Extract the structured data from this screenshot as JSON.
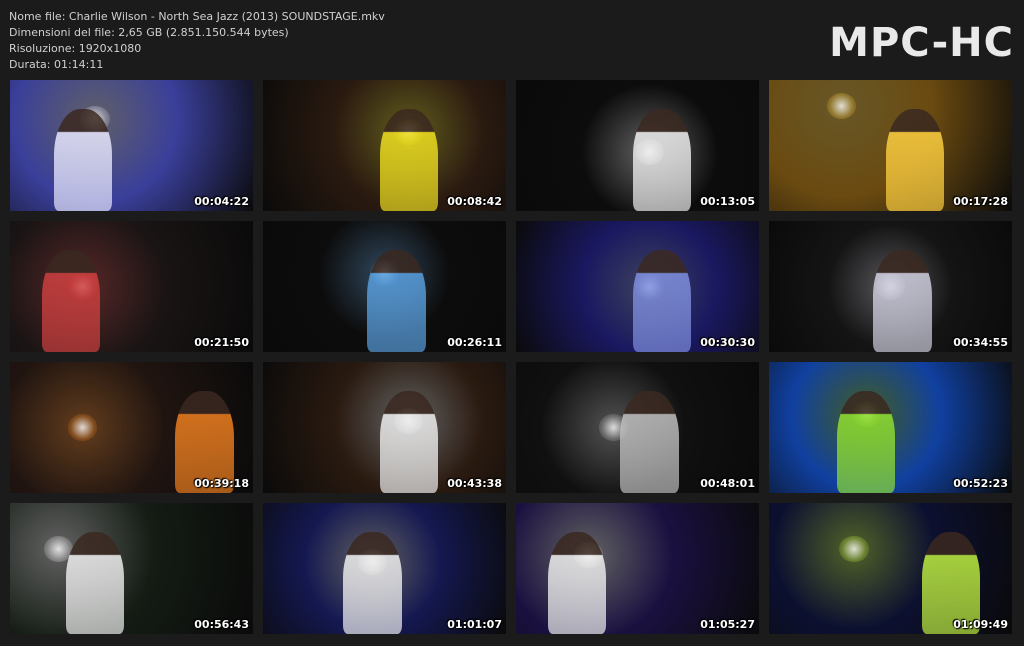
{
  "file_info": {
    "name_line": "Nome file: Charlie Wilson - North Sea Jazz (2013) SOUNDSTAGE.mkv",
    "size_line": "Dimensioni del file: 2,65 GB (2.851.150.544 bytes)",
    "resolution_line": "Risoluzione: 1920x1080",
    "duration_line": "Durata: 01:14:11"
  },
  "logo": "MPC-HC",
  "thumbnails": [
    {
      "timestamp": "00:04:22",
      "bg": "#3a3f9a",
      "accent": "#e8e8ff"
    },
    {
      "timestamp": "00:08:42",
      "bg": "#2a1a10",
      "accent": "#f0e020"
    },
    {
      "timestamp": "00:13:05",
      "bg": "#0c0c0c",
      "accent": "#f0f0f0"
    },
    {
      "timestamp": "00:17:28",
      "bg": "#6a4a10",
      "accent": "#ffd040"
    },
    {
      "timestamp": "00:21:50",
      "bg": "#1a1414",
      "accent": "#d04040"
    },
    {
      "timestamp": "00:26:11",
      "bg": "#0c0c0c",
      "accent": "#5aa0e0"
    },
    {
      "timestamp": "00:30:30",
      "bg": "#1a1860",
      "accent": "#8090e0"
    },
    {
      "timestamp": "00:34:55",
      "bg": "#141414",
      "accent": "#d0d0e0"
    },
    {
      "timestamp": "00:39:18",
      "bg": "#201410",
      "accent": "#f08020"
    },
    {
      "timestamp": "00:43:38",
      "bg": "#2a1a10",
      "accent": "#f0f0f0"
    },
    {
      "timestamp": "00:48:01",
      "bg": "#101010",
      "accent": "#c0c0c0"
    },
    {
      "timestamp": "00:52:23",
      "bg": "#1040a0",
      "accent": "#90e030"
    },
    {
      "timestamp": "00:56:43",
      "bg": "#141c14",
      "accent": "#f0f0f0"
    },
    {
      "timestamp": "01:01:07",
      "bg": "#141850",
      "accent": "#f0f0f0"
    },
    {
      "timestamp": "01:05:27",
      "bg": "#1a1040",
      "accent": "#f0f0f0"
    },
    {
      "timestamp": "01:09:49",
      "bg": "#0c1030",
      "accent": "#c0f040"
    }
  ]
}
